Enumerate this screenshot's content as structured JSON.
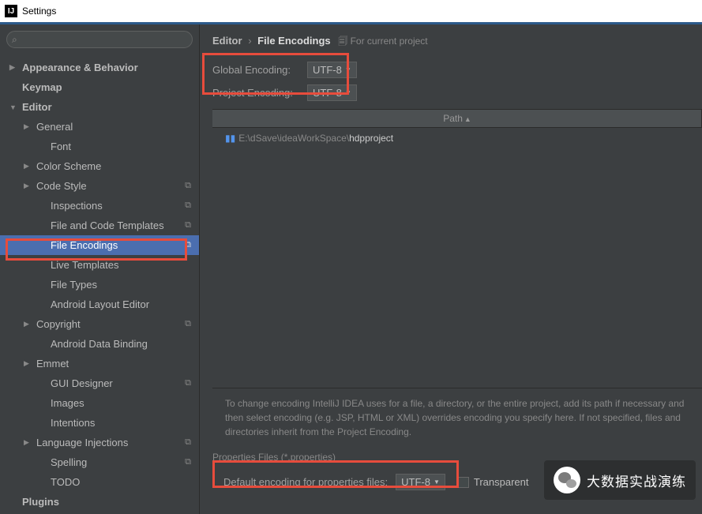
{
  "window": {
    "title": "Settings"
  },
  "search": {
    "placeholder": ""
  },
  "sidebar": {
    "items": [
      {
        "label": "Appearance & Behavior",
        "level": 1,
        "arrow": "▶"
      },
      {
        "label": "Keymap",
        "level": 1,
        "arrow": ""
      },
      {
        "label": "Editor",
        "level": 1,
        "arrow": "▼"
      },
      {
        "label": "General",
        "level": 2,
        "arrow": "▶"
      },
      {
        "label": "Font",
        "level": 3,
        "arrow": ""
      },
      {
        "label": "Color Scheme",
        "level": 2,
        "arrow": "▶"
      },
      {
        "label": "Code Style",
        "level": 2,
        "arrow": "▶",
        "copy": true
      },
      {
        "label": "Inspections",
        "level": 3,
        "arrow": "",
        "copy": true
      },
      {
        "label": "File and Code Templates",
        "level": 3,
        "arrow": "",
        "copy": true
      },
      {
        "label": "File Encodings",
        "level": 3,
        "arrow": "",
        "copy": true,
        "selected": true
      },
      {
        "label": "Live Templates",
        "level": 3,
        "arrow": ""
      },
      {
        "label": "File Types",
        "level": 3,
        "arrow": ""
      },
      {
        "label": "Android Layout Editor",
        "level": 3,
        "arrow": ""
      },
      {
        "label": "Copyright",
        "level": 2,
        "arrow": "▶",
        "copy": true
      },
      {
        "label": "Android Data Binding",
        "level": 3,
        "arrow": ""
      },
      {
        "label": "Emmet",
        "level": 2,
        "arrow": "▶"
      },
      {
        "label": "GUI Designer",
        "level": 3,
        "arrow": "",
        "copy": true
      },
      {
        "label": "Images",
        "level": 3,
        "arrow": ""
      },
      {
        "label": "Intentions",
        "level": 3,
        "arrow": ""
      },
      {
        "label": "Language Injections",
        "level": 2,
        "arrow": "▶",
        "copy": true
      },
      {
        "label": "Spelling",
        "level": 3,
        "arrow": "",
        "copy": true
      },
      {
        "label": "TODO",
        "level": 3,
        "arrow": ""
      },
      {
        "label": "Plugins",
        "level": 1,
        "arrow": ""
      }
    ]
  },
  "breadcrumb": {
    "part1": "Editor",
    "part2": "File Encodings",
    "meta": "For current project"
  },
  "encoding": {
    "global_label": "Global Encoding:",
    "global_value": "UTF-8",
    "project_label": "Project Encoding:",
    "project_value": "UTF-8"
  },
  "path_header": "Path",
  "file_path": {
    "prefix": "E:\\dSave\\ideaWorkSpace\\",
    "name": "hdpproject"
  },
  "hint": "To change encoding IntelliJ IDEA uses for a file, a directory, or the entire project, add its path if necessary and then select encoding (e.g. JSP, HTML or XML) overrides encoding you specify here. If not specified, files and directories inherit from the Project Encoding.",
  "properties": {
    "section_title": "Properties Files (*.properties)",
    "label": "Default encoding for properties files:",
    "value": "UTF-8",
    "checkbox_label": "Transparent"
  },
  "overlay": {
    "text": "大数据实战演练"
  }
}
